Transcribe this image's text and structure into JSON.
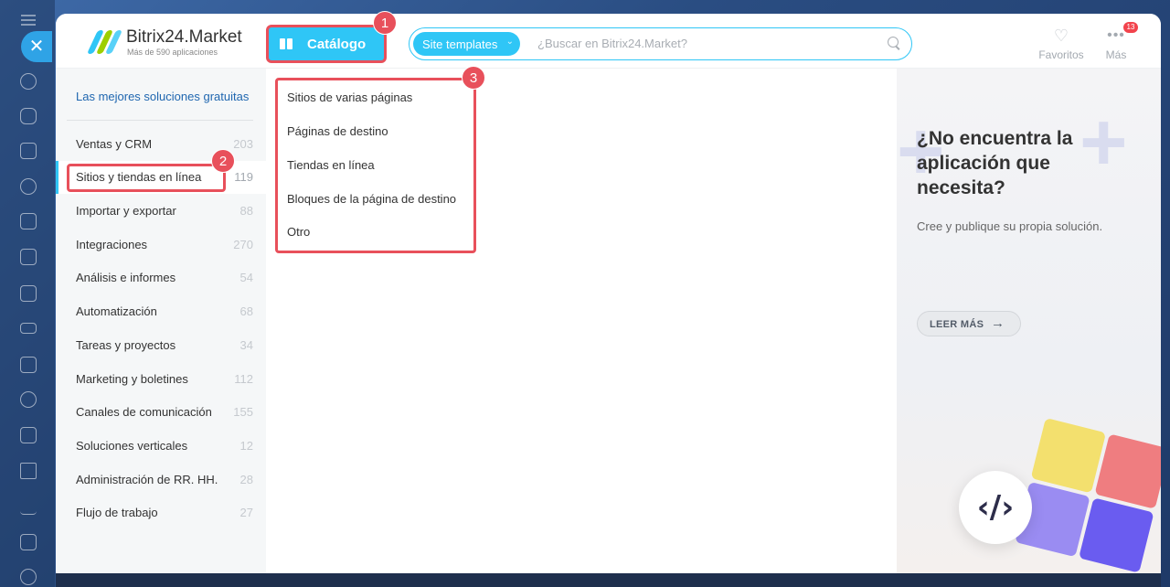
{
  "header": {
    "brand_title": "Bitrix24.Market",
    "brand_sub": "Más de 590 aplicaciones",
    "catalog_label": "Catálogo",
    "search_tag": "Site templates",
    "search_placeholder": "¿Buscar en Bitrix24.Market?",
    "favorites_label": "Favoritos",
    "more_label": "Más",
    "more_count": "13"
  },
  "sidebar": {
    "promo": "Las mejores soluciones gratuitas",
    "categories": [
      {
        "name": "Ventas y CRM",
        "count": "203"
      },
      {
        "name": "Sitios y tiendas en línea",
        "count": "119"
      },
      {
        "name": "Importar y exportar",
        "count": "88"
      },
      {
        "name": "Integraciones",
        "count": "270"
      },
      {
        "name": "Análisis e informes",
        "count": "54"
      },
      {
        "name": "Automatización",
        "count": "68"
      },
      {
        "name": "Tareas y proyectos",
        "count": "34"
      },
      {
        "name": "Marketing y boletines",
        "count": "112"
      },
      {
        "name": "Canales de comunicación",
        "count": "155"
      },
      {
        "name": "Soluciones verticales",
        "count": "12"
      },
      {
        "name": "Administración de RR. HH.",
        "count": "28"
      },
      {
        "name": "Flujo de trabajo",
        "count": "27"
      }
    ]
  },
  "submenu": {
    "items": [
      "Sitios de varias páginas",
      "Páginas de destino",
      "Tiendas en línea",
      "Bloques de la página de destino",
      "Otro"
    ]
  },
  "promo_panel": {
    "title": "¿No encuentra la aplicación que necesita?",
    "desc": "Cree y publique su propia solución.",
    "button": "LEER MÁS"
  },
  "badges": [
    "1",
    "2",
    "3"
  ],
  "colors": {
    "accent": "#2fc6f6",
    "highlight": "#e8505b",
    "link": "#2067b0"
  }
}
